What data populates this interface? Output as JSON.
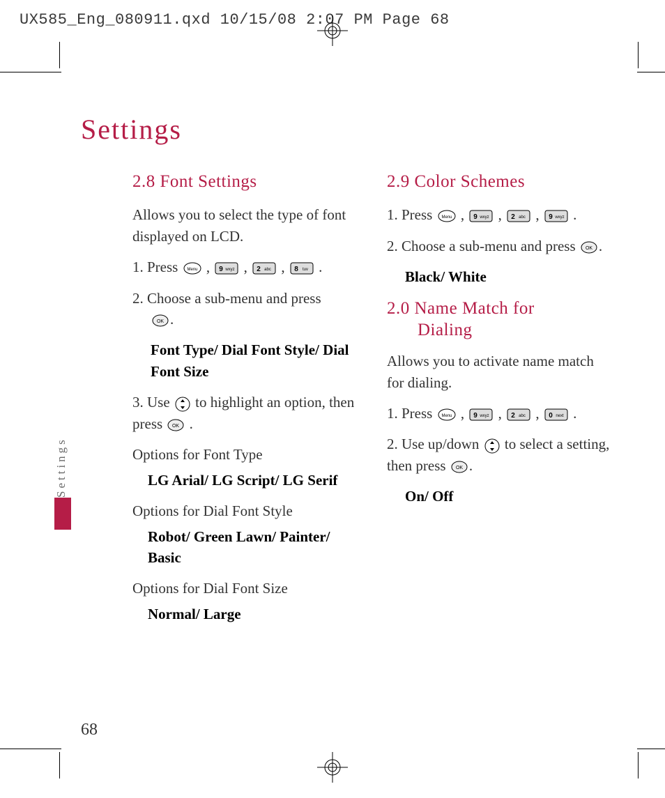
{
  "prepress": "UX585_Eng_080911.qxd  10/15/08  2:07 PM  Page 68",
  "title": "Settings",
  "side_tab": "Settings",
  "page_number": "68",
  "keys": {
    "menu": "Menu",
    "ok": "OK",
    "nine": "9 wxyz",
    "two": "2 abc",
    "eight": "8 tuv",
    "zero": "0 next",
    "nav": "nav"
  },
  "left": {
    "h": "2.8 Font Settings",
    "intro": "Allows you to select the type of font displayed on LCD.",
    "s1a": "1. Press ",
    "s1b": " , ",
    "s1c": " , ",
    "s1d": " , ",
    "s1e": " .",
    "s2a": "2. Choose a sub-menu and press ",
    "s2b": ".",
    "s2opts": "Font Type/ Dial Font Style/ Dial Font Size",
    "s3a": "3. Use ",
    "s3b": " to highlight an option, then press ",
    "s3c": " .",
    "o1l": "Options for Font Type",
    "o1v": "LG Arial/ LG Script/ LG Serif",
    "o2l": "Options for Dial Font Style",
    "o2v": "Robot/ Green Lawn/ Painter/ Basic",
    "o3l": "Options for Dial Font Size",
    "o3v": "Normal/ Large"
  },
  "right": {
    "h1": "2.9 Color Schemes",
    "r1s1a": "1. Press ",
    "r1s1b": " , ",
    "r1s1c": " , ",
    "r1s1d": " , ",
    "r1s1e": " .",
    "r1s2a": "2. Choose a sub-menu and press ",
    "r1s2b": ".",
    "r1opts": "Black/ White",
    "h2a": "2.0 Name Match for",
    "h2b": "Dialing",
    "r2intro": "Allows you to activate name match for dialing.",
    "r2s1a": "1. Press ",
    "r2s1b": " , ",
    "r2s1c": " , ",
    "r2s1d": " , ",
    "r2s1e": " .",
    "r2s2a": "2. Use up/down ",
    "r2s2b": " to select a setting, then press ",
    "r2s2c": ".",
    "r2opts": "On/ Off"
  }
}
